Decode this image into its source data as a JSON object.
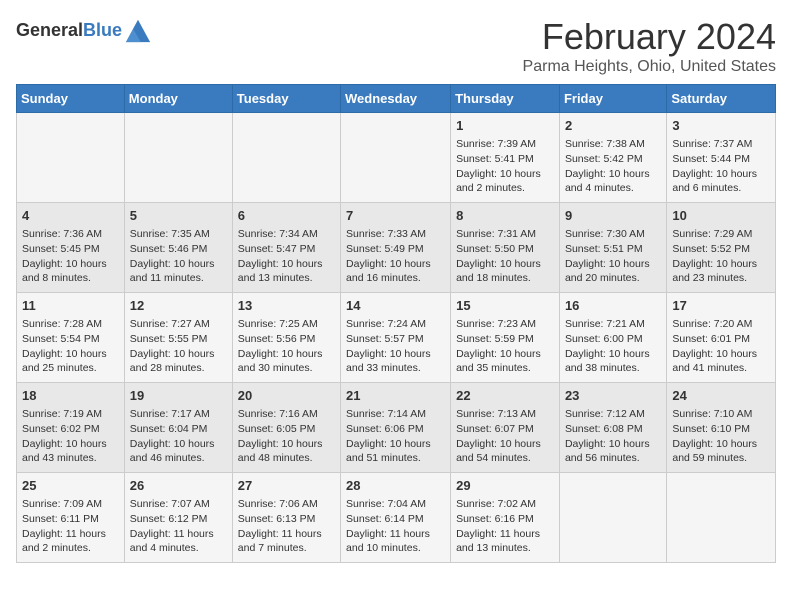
{
  "header": {
    "logo_general": "General",
    "logo_blue": "Blue",
    "title": "February 2024",
    "subtitle": "Parma Heights, Ohio, United States"
  },
  "weekdays": [
    "Sunday",
    "Monday",
    "Tuesday",
    "Wednesday",
    "Thursday",
    "Friday",
    "Saturday"
  ],
  "weeks": [
    [
      {
        "day": "",
        "info": ""
      },
      {
        "day": "",
        "info": ""
      },
      {
        "day": "",
        "info": ""
      },
      {
        "day": "",
        "info": ""
      },
      {
        "day": "1",
        "info": "Sunrise: 7:39 AM\nSunset: 5:41 PM\nDaylight: 10 hours and 2 minutes."
      },
      {
        "day": "2",
        "info": "Sunrise: 7:38 AM\nSunset: 5:42 PM\nDaylight: 10 hours and 4 minutes."
      },
      {
        "day": "3",
        "info": "Sunrise: 7:37 AM\nSunset: 5:44 PM\nDaylight: 10 hours and 6 minutes."
      }
    ],
    [
      {
        "day": "4",
        "info": "Sunrise: 7:36 AM\nSunset: 5:45 PM\nDaylight: 10 hours and 8 minutes."
      },
      {
        "day": "5",
        "info": "Sunrise: 7:35 AM\nSunset: 5:46 PM\nDaylight: 10 hours and 11 minutes."
      },
      {
        "day": "6",
        "info": "Sunrise: 7:34 AM\nSunset: 5:47 PM\nDaylight: 10 hours and 13 minutes."
      },
      {
        "day": "7",
        "info": "Sunrise: 7:33 AM\nSunset: 5:49 PM\nDaylight: 10 hours and 16 minutes."
      },
      {
        "day": "8",
        "info": "Sunrise: 7:31 AM\nSunset: 5:50 PM\nDaylight: 10 hours and 18 minutes."
      },
      {
        "day": "9",
        "info": "Sunrise: 7:30 AM\nSunset: 5:51 PM\nDaylight: 10 hours and 20 minutes."
      },
      {
        "day": "10",
        "info": "Sunrise: 7:29 AM\nSunset: 5:52 PM\nDaylight: 10 hours and 23 minutes."
      }
    ],
    [
      {
        "day": "11",
        "info": "Sunrise: 7:28 AM\nSunset: 5:54 PM\nDaylight: 10 hours and 25 minutes."
      },
      {
        "day": "12",
        "info": "Sunrise: 7:27 AM\nSunset: 5:55 PM\nDaylight: 10 hours and 28 minutes."
      },
      {
        "day": "13",
        "info": "Sunrise: 7:25 AM\nSunset: 5:56 PM\nDaylight: 10 hours and 30 minutes."
      },
      {
        "day": "14",
        "info": "Sunrise: 7:24 AM\nSunset: 5:57 PM\nDaylight: 10 hours and 33 minutes."
      },
      {
        "day": "15",
        "info": "Sunrise: 7:23 AM\nSunset: 5:59 PM\nDaylight: 10 hours and 35 minutes."
      },
      {
        "day": "16",
        "info": "Sunrise: 7:21 AM\nSunset: 6:00 PM\nDaylight: 10 hours and 38 minutes."
      },
      {
        "day": "17",
        "info": "Sunrise: 7:20 AM\nSunset: 6:01 PM\nDaylight: 10 hours and 41 minutes."
      }
    ],
    [
      {
        "day": "18",
        "info": "Sunrise: 7:19 AM\nSunset: 6:02 PM\nDaylight: 10 hours and 43 minutes."
      },
      {
        "day": "19",
        "info": "Sunrise: 7:17 AM\nSunset: 6:04 PM\nDaylight: 10 hours and 46 minutes."
      },
      {
        "day": "20",
        "info": "Sunrise: 7:16 AM\nSunset: 6:05 PM\nDaylight: 10 hours and 48 minutes."
      },
      {
        "day": "21",
        "info": "Sunrise: 7:14 AM\nSunset: 6:06 PM\nDaylight: 10 hours and 51 minutes."
      },
      {
        "day": "22",
        "info": "Sunrise: 7:13 AM\nSunset: 6:07 PM\nDaylight: 10 hours and 54 minutes."
      },
      {
        "day": "23",
        "info": "Sunrise: 7:12 AM\nSunset: 6:08 PM\nDaylight: 10 hours and 56 minutes."
      },
      {
        "day": "24",
        "info": "Sunrise: 7:10 AM\nSunset: 6:10 PM\nDaylight: 10 hours and 59 minutes."
      }
    ],
    [
      {
        "day": "25",
        "info": "Sunrise: 7:09 AM\nSunset: 6:11 PM\nDaylight: 11 hours and 2 minutes."
      },
      {
        "day": "26",
        "info": "Sunrise: 7:07 AM\nSunset: 6:12 PM\nDaylight: 11 hours and 4 minutes."
      },
      {
        "day": "27",
        "info": "Sunrise: 7:06 AM\nSunset: 6:13 PM\nDaylight: 11 hours and 7 minutes."
      },
      {
        "day": "28",
        "info": "Sunrise: 7:04 AM\nSunset: 6:14 PM\nDaylight: 11 hours and 10 minutes."
      },
      {
        "day": "29",
        "info": "Sunrise: 7:02 AM\nSunset: 6:16 PM\nDaylight: 11 hours and 13 minutes."
      },
      {
        "day": "",
        "info": ""
      },
      {
        "day": "",
        "info": ""
      }
    ]
  ]
}
